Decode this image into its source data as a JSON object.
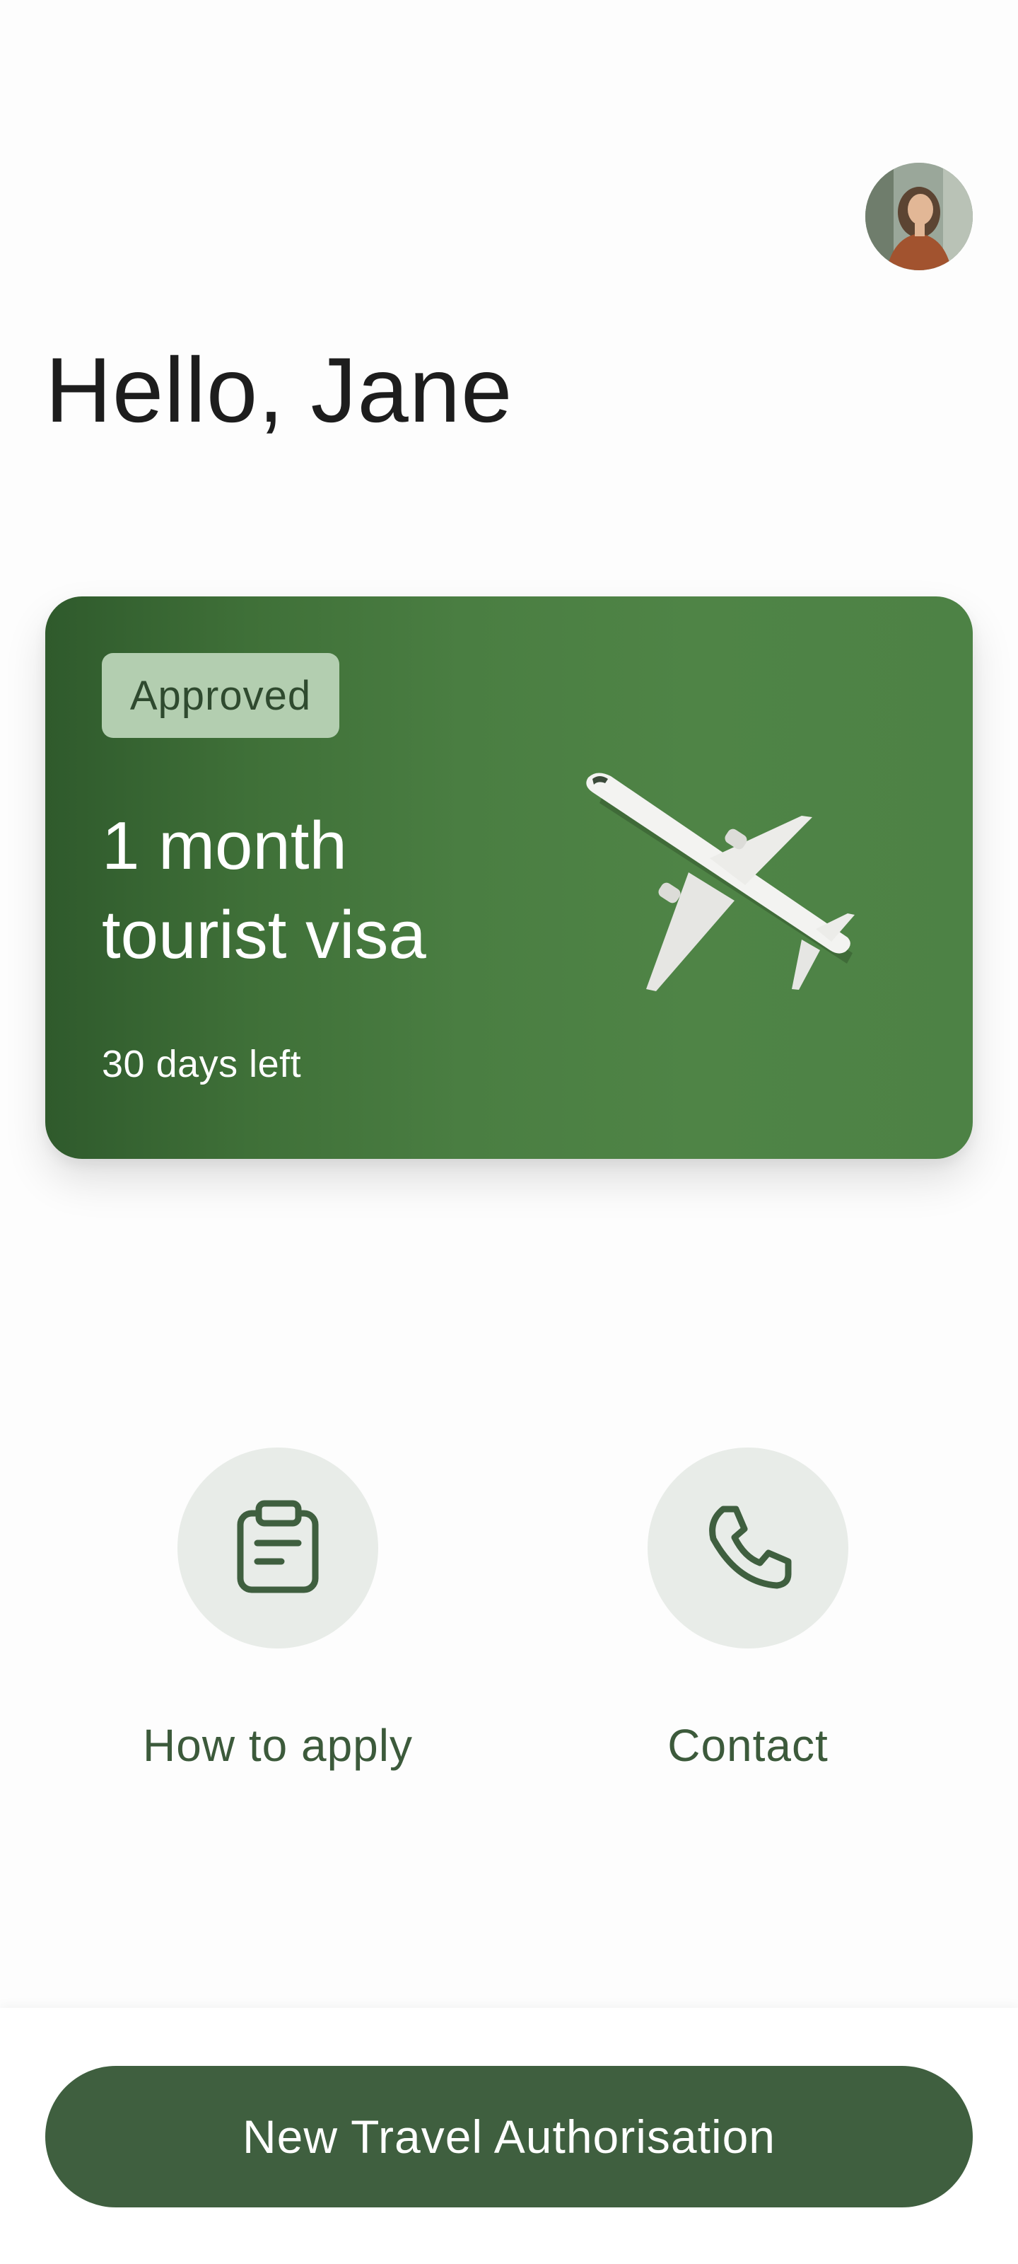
{
  "header": {
    "avatar_icon": "user-avatar-photo"
  },
  "greeting": {
    "text": "Hello, Jane"
  },
  "visa_card": {
    "status": "Approved",
    "title_line1": "1 month",
    "title_line2": "tourist visa",
    "days_left": "30 days left",
    "image_icon": "airplane-icon",
    "colors": {
      "card_dark": "#2f5a2c",
      "card_light": "#4f8446",
      "badge_bg": "#b3ceb0",
      "badge_text": "#2f4a2f"
    }
  },
  "actions": [
    {
      "label": "How to apply",
      "icon": "clipboard-icon"
    },
    {
      "label": "Contact",
      "icon": "phone-icon"
    }
  ],
  "footer": {
    "primary_button_label": "New Travel Authorisation",
    "button_color": "#3f5f3f"
  }
}
